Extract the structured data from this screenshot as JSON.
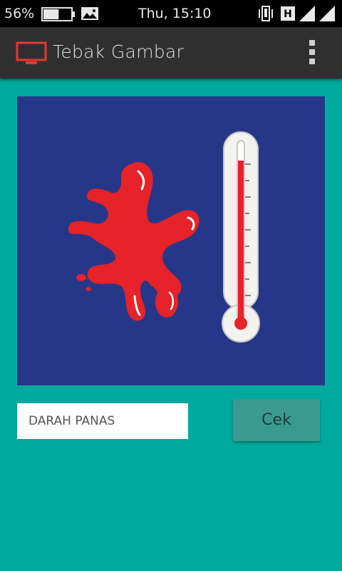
{
  "status_bar": {
    "battery_percent": "56%",
    "battery_level": 0.56,
    "time": "Thu, 15:10",
    "network_badge": "H",
    "icons": [
      "battery-icon",
      "gallery-icon",
      "vibrate-icon",
      "signal-icon",
      "signal-icon"
    ]
  },
  "app_bar": {
    "title": "Tebak Gambar",
    "icon": "monitor-icon",
    "accent_color": "#e53935"
  },
  "puzzle": {
    "image_description_icons": [
      "blood-splat-icon",
      "thermometer-icon"
    ],
    "background_color": "#26378a"
  },
  "answer": {
    "value": "DARAH PANAS"
  },
  "check_button": {
    "label": "Cek"
  },
  "colors": {
    "background": "#00a99d",
    "app_bar": "#2f2f2f",
    "button": "#3a9a91"
  }
}
